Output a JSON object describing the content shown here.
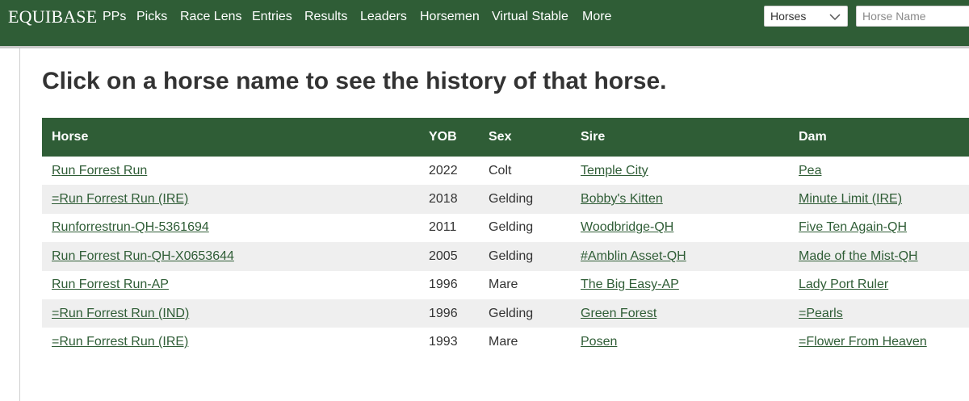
{
  "topbar": {
    "logo": "EQUIBASE",
    "nav": [
      "PPs",
      "Picks",
      "Race Lens",
      "Entries",
      "Results",
      "Leaders",
      "Horsemen",
      "Virtual Stable",
      "More"
    ],
    "search_type": "Horses",
    "search_placeholder": "Horse Name",
    "colors": {
      "bar": "#2f5d36",
      "link": "#2f5d36"
    }
  },
  "main": {
    "heading": "Click on a horse name to see the history of that horse.",
    "table": {
      "headers": {
        "horse": "Horse",
        "yob": "YOB",
        "sex": "Sex",
        "sire": "Sire",
        "dam": "Dam"
      },
      "rows": [
        {
          "horse": "Run Forrest Run",
          "yob": "2022",
          "sex": "Colt",
          "sire": "Temple City",
          "dam": "Pea"
        },
        {
          "horse": "=Run Forrest Run (IRE)",
          "yob": "2018",
          "sex": "Gelding",
          "sire": "Bobby's Kitten",
          "dam": "Minute Limit (IRE)"
        },
        {
          "horse": "Runforrestrun-QH-5361694",
          "yob": "2011",
          "sex": "Gelding",
          "sire": "Woodbridge-QH",
          "dam": "Five Ten Again-QH"
        },
        {
          "horse": "Run Forrest Run-QH-X0653644",
          "yob": "2005",
          "sex": "Gelding",
          "sire": "#Amblin Asset-QH",
          "dam": "Made of the Mist-QH"
        },
        {
          "horse": "Run Forrest Run-AP",
          "yob": "1996",
          "sex": "Mare",
          "sire": "The Big Easy-AP",
          "dam": "Lady Port Ruler"
        },
        {
          "horse": "=Run Forrest Run (IND)",
          "yob": "1996",
          "sex": "Gelding",
          "sire": "Green Forest",
          "dam": "=Pearls"
        },
        {
          "horse": "=Run Forrest Run (IRE)",
          "yob": "1993",
          "sex": "Mare",
          "sire": "Posen",
          "dam": "=Flower From Heaven"
        }
      ]
    }
  }
}
